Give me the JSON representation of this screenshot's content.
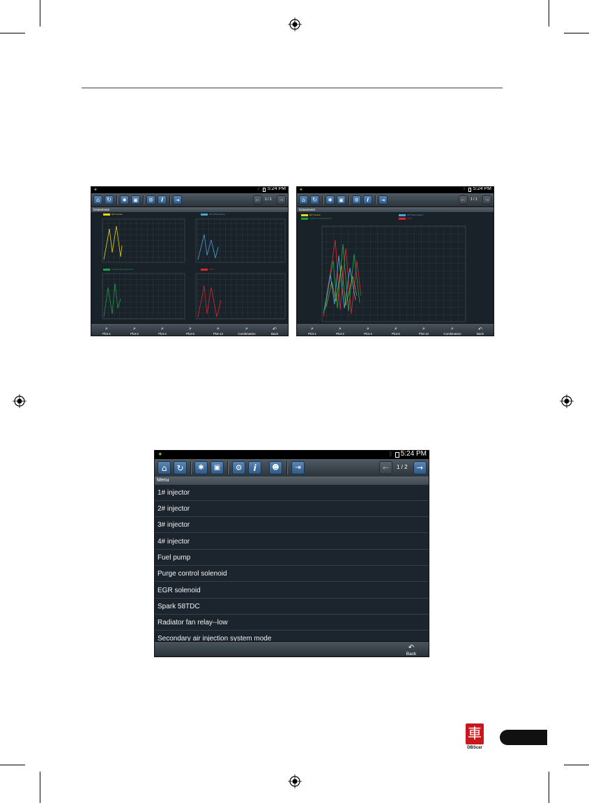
{
  "status": {
    "time": "5:24 PM"
  },
  "screen_a": {
    "section": "Datastream",
    "pager": "1 / 1",
    "legends": [
      "ECT sensor",
      "IAT (Test system)",
      "Coolant air temperature",
      "RPM"
    ],
    "bottom": [
      "Plot-1",
      "Plot-2",
      "Plot-4",
      "Plot-6",
      "Plot-12",
      "Combination",
      "Back"
    ]
  },
  "screen_b": {
    "section": "Datastream",
    "pager": "1 / 1",
    "legends": [
      "ECT sensor",
      "Coolant air temperature",
      "IAT (Test system)",
      "RPM"
    ],
    "bottom": [
      "Plot-1",
      "Plot-2",
      "Plot-4",
      "Plot-6",
      "Plot-12",
      "Combination",
      "Back"
    ]
  },
  "screen_c": {
    "section": "Menu",
    "pager": "1 / 2",
    "items": [
      "1# injector",
      "2# injector",
      "3# injector",
      "4# injector",
      "Fuel pump",
      "Purge control solenoid",
      "EGR solenoid",
      "Spark 58TDC",
      "Radiator fan relay--low",
      "Secondary air injection system mode"
    ],
    "back": "Back"
  },
  "brand": {
    "logo_text": "DBScar",
    "logo_glyph": "車"
  },
  "colors": {
    "yellow": "#e8d51a",
    "blue": "#4aa3d9",
    "green": "#1f9e4a",
    "red": "#d8262c"
  }
}
